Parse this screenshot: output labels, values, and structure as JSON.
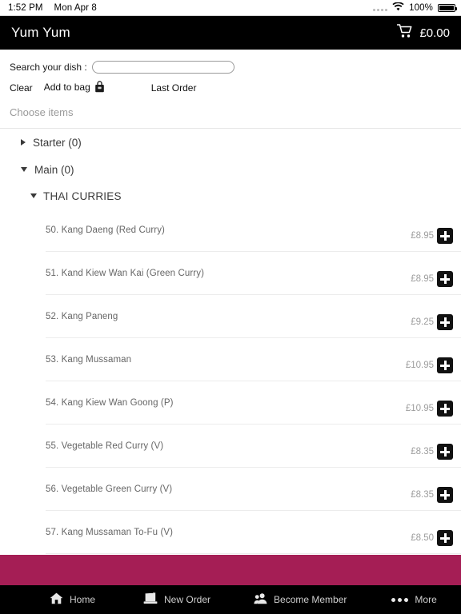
{
  "status_bar": {
    "time": "1:52 PM",
    "date": "Mon Apr 8",
    "wifi_icon": "wifi-icon",
    "battery_percent": "100%",
    "battery_icon": "battery-full-icon"
  },
  "app_bar": {
    "title": "Yum Yum",
    "cart_icon": "shopping-cart-icon",
    "cart_total": "£0.00"
  },
  "search": {
    "label": "Search your dish :",
    "value": "",
    "placeholder": ""
  },
  "actions": {
    "clear": "Clear",
    "add_to_bag": "Add to bag",
    "bag_icon": "shopping-bag-icon",
    "last_order": "Last Order"
  },
  "section_heading": "Choose items",
  "accordion": [
    {
      "label": "Starter (0)",
      "expanded": false,
      "marker": "triangle-right-icon"
    },
    {
      "label": "Main (0)",
      "expanded": true,
      "marker": "triangle-down-icon"
    }
  ],
  "subsection": {
    "label": "THAI CURRIES",
    "expanded": true,
    "marker": "triangle-down-icon"
  },
  "items": [
    {
      "name": "50. Kang Daeng (Red Curry)",
      "price": "£8.95",
      "add_icon": "plus-icon"
    },
    {
      "name": "51. Kand Kiew Wan Kai (Green Curry)",
      "price": "£8.95",
      "add_icon": "plus-icon"
    },
    {
      "name": "52. Kang Paneng",
      "price": "£9.25",
      "add_icon": "plus-icon"
    },
    {
      "name": "53. Kang Mussaman",
      "price": "£10.95",
      "add_icon": "plus-icon"
    },
    {
      "name": "54. Kang Kiew Wan Goong (P)",
      "price": "£10.95",
      "add_icon": "plus-icon"
    },
    {
      "name": "55. Vegetable Red Curry (V)",
      "price": "£8.35",
      "add_icon": "plus-icon"
    },
    {
      "name": "56. Vegetable Green Curry (V)",
      "price": "£8.35",
      "add_icon": "plus-icon"
    },
    {
      "name": "57. Kang Mussaman To-Fu (V)",
      "price": "£8.50",
      "add_icon": "plus-icon"
    }
  ],
  "tabbar": [
    {
      "label": "Home",
      "icon": "home-icon"
    },
    {
      "label": "New Order",
      "icon": "new-order-icon"
    },
    {
      "label": "Become Member",
      "icon": "person-icon"
    },
    {
      "label": "More",
      "icon": "ellipsis-icon"
    }
  ],
  "colors": {
    "accent_band": "#a51e55",
    "app_bar": "#000000",
    "tab_bar": "#000000",
    "item_text": "#666666",
    "price_text": "#9d9d9d"
  }
}
